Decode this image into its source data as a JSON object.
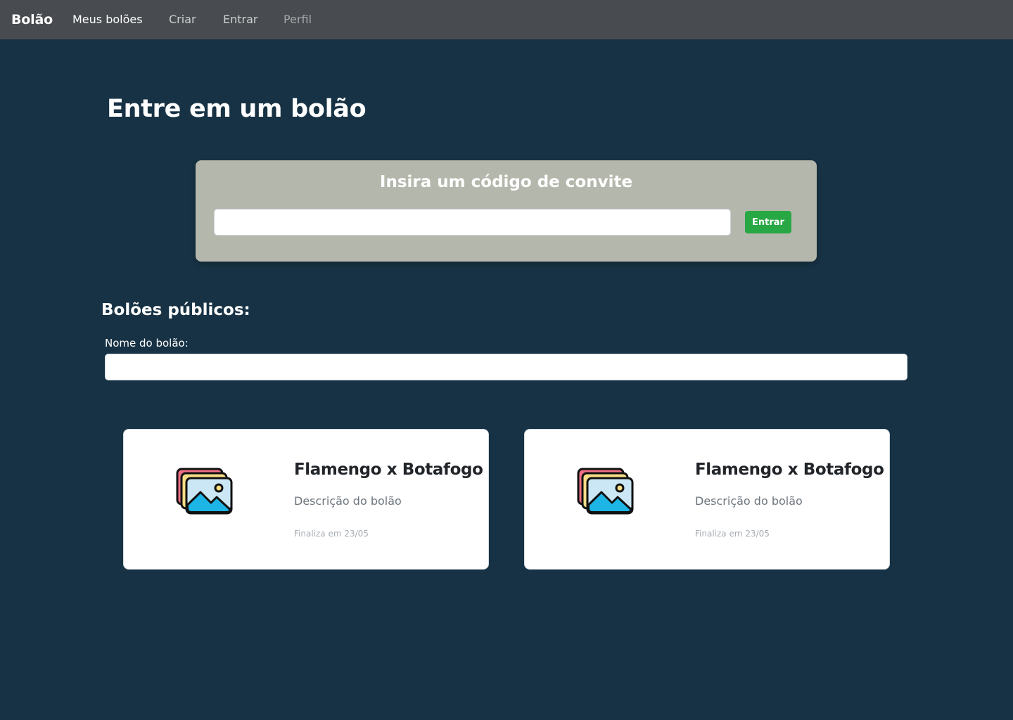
{
  "navbar": {
    "brand": "Bolão",
    "links": [
      {
        "label": "Meus bolões"
      },
      {
        "label": "Criar"
      },
      {
        "label": "Entrar"
      },
      {
        "label": "Perfil"
      }
    ]
  },
  "page": {
    "title": "Entre em um bolão"
  },
  "invite": {
    "heading": "Insira um código de convite",
    "input_value": "",
    "button_label": "Entrar"
  },
  "public": {
    "title": "Bolões públicos:",
    "filter_label": "Nome do bolão:",
    "filter_value": ""
  },
  "cards": [
    {
      "icon": "images-icon",
      "title": "Flamengo x Botafogo",
      "description": "Descrição do bolão",
      "ends": "Finaliza em 23/05"
    },
    {
      "icon": "images-icon",
      "title": "Flamengo x Botafogo",
      "description": "Descrição do bolão",
      "ends": "Finaliza em 23/05"
    }
  ],
  "colors": {
    "background": "#173244",
    "navbar": "#484c50",
    "invite_panel": "#b4b7ab",
    "success_button": "#28a745"
  }
}
